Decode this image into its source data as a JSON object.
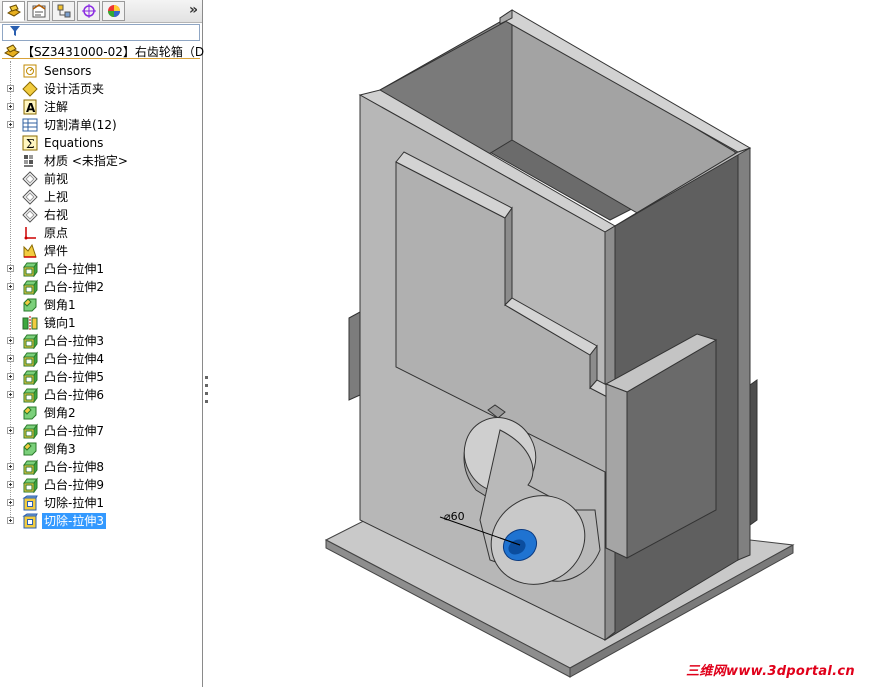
{
  "feature_tree": {
    "tabs": [
      {
        "name": "featuremanager-tab"
      },
      {
        "name": "propertymanager-tab"
      },
      {
        "name": "configurationmanager-tab"
      },
      {
        "name": "dimxpert-tab"
      },
      {
        "name": "display-manager-tab"
      }
    ],
    "expand_glyph": "»",
    "root": "【SZ3431000-02】右齿轮箱（D",
    "items": [
      {
        "label": "Sensors",
        "icon": "sensors-icon",
        "expandable": false
      },
      {
        "label": "设计活页夹",
        "icon": "design-binder-icon",
        "expandable": true
      },
      {
        "label": "注解",
        "icon": "annotations-icon",
        "expandable": true
      },
      {
        "label": "切割清单(12)",
        "icon": "cut-list-icon",
        "expandable": true
      },
      {
        "label": "Equations",
        "icon": "equations-icon",
        "expandable": false
      },
      {
        "label": "材质 <未指定>",
        "icon": "material-icon",
        "expandable": false
      },
      {
        "label": "前视",
        "icon": "plane-icon",
        "expandable": false
      },
      {
        "label": "上视",
        "icon": "plane-icon",
        "expandable": false
      },
      {
        "label": "右视",
        "icon": "plane-icon",
        "expandable": false
      },
      {
        "label": "原点",
        "icon": "origin-icon",
        "expandable": false
      },
      {
        "label": "焊件",
        "icon": "weldment-icon",
        "expandable": false
      },
      {
        "label": "凸台-拉伸1",
        "icon": "boss-extrude-icon",
        "expandable": true
      },
      {
        "label": "凸台-拉伸2",
        "icon": "boss-extrude-icon",
        "expandable": true
      },
      {
        "label": "倒角1",
        "icon": "chamfer-icon",
        "expandable": false
      },
      {
        "label": "镜向1",
        "icon": "mirror-icon",
        "expandable": false
      },
      {
        "label": "凸台-拉伸3",
        "icon": "boss-extrude-icon",
        "expandable": true
      },
      {
        "label": "凸台-拉伸4",
        "icon": "boss-extrude-icon",
        "expandable": true
      },
      {
        "label": "凸台-拉伸5",
        "icon": "boss-extrude-icon",
        "expandable": true
      },
      {
        "label": "凸台-拉伸6",
        "icon": "boss-extrude-icon",
        "expandable": true
      },
      {
        "label": "倒角2",
        "icon": "chamfer-icon",
        "expandable": false
      },
      {
        "label": "凸台-拉伸7",
        "icon": "boss-extrude-icon",
        "expandable": true
      },
      {
        "label": "倒角3",
        "icon": "chamfer-icon",
        "expandable": false
      },
      {
        "label": "凸台-拉伸8",
        "icon": "boss-extrude-icon",
        "expandable": true
      },
      {
        "label": "凸台-拉伸9",
        "icon": "boss-extrude-icon",
        "expandable": true
      },
      {
        "label": "切除-拉伸1",
        "icon": "cut-extrude-icon",
        "expandable": true
      },
      {
        "label": "切除-拉伸3",
        "icon": "cut-extrude-icon",
        "expandable": true,
        "selected": true
      }
    ]
  },
  "viewport": {
    "dimension_label": "⌀60",
    "watermark": "三维网www.3dportal.cn"
  },
  "colors": {
    "selection": "#3399ff",
    "model_light": "#b4b4b4",
    "model_dark": "#5e5e5e",
    "hole_blue": "#1f73d1",
    "watermark": "#e0001a"
  }
}
